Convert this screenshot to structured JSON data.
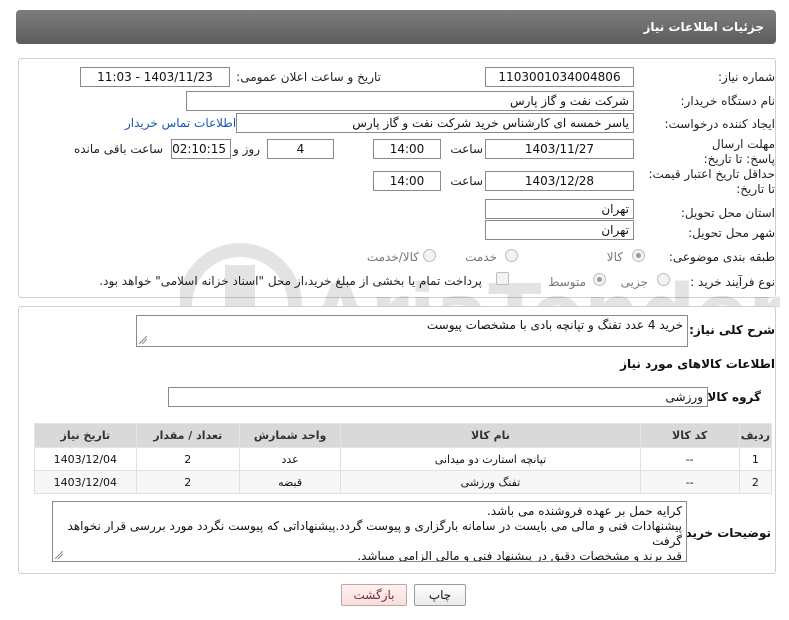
{
  "header": {
    "title": "جزئیات اطلاعات نیاز"
  },
  "labels": {
    "need_number": "شماره نیاز:",
    "announce_datetime": "تاریخ و ساعت اعلان عمومی:",
    "buyer_org": "نام دستگاه خریدار:",
    "requester": "ایجاد کننده درخواست:",
    "reply_deadline": "مهلت ارسال پاسخ: تا تاریخ:",
    "time": "ساعت",
    "day_and": "روز و",
    "remaining": "ساعت باقی مانده",
    "price_validity": "حداقل تاریخ اعتبار قیمت: تا تاریخ:",
    "delivery_province": "استان محل تحویل:",
    "delivery_city": "شهر محل تحویل:",
    "category": "طبقه بندی موضوعی:",
    "process_type": "نوع فرآیند خرید :",
    "general_desc": "شرح کلی نیاز:",
    "goods_info": "اطلاعات کالاهای مورد نیاز",
    "goods_group": "گروه کالا:",
    "buyer_notes": "توضیحات خریدار:"
  },
  "values": {
    "need_number": "1103001034004806",
    "announce_datetime": "1403/11/23 - 11:03",
    "buyer_org": "شرکت نفت و گاز پارس",
    "requester": "یاسر  خمسه ای کارشناس خرید  شرکت نفت و گاز پارس",
    "contact_link": "اطلاعات تماس خریدار",
    "reply_date": "1403/11/27",
    "reply_time": "14:00",
    "days": "4",
    "remaining_time": "02:10:15",
    "validity_date": "1403/12/28",
    "validity_time": "14:00",
    "province": "تهران",
    "city": "تهران",
    "general_desc": "خرید 4 عدد تفنگ و تپانچه بادی با مشخصات پیوست",
    "goods_group": "ورزشی"
  },
  "category_options": [
    {
      "label": "کالا",
      "selected": true
    },
    {
      "label": "خدمت",
      "selected": false
    },
    {
      "label": "کالا/خدمت",
      "selected": false
    }
  ],
  "process_options": [
    {
      "label": "جزیی",
      "selected": false
    },
    {
      "label": "متوسط",
      "selected": true
    }
  ],
  "treasury_note": "پرداخت تمام یا بخشی از مبلغ خرید،از محل \"اسناد خزانه اسلامی\" خواهد بود.",
  "table": {
    "headers": [
      "ردیف",
      "کد کالا",
      "نام کالا",
      "واحد شمارش",
      "تعداد / مقدار",
      "تاریخ نیاز"
    ],
    "rows": [
      [
        "1",
        "--",
        "تپانچه استارت دو میدانی",
        "عدد",
        "2",
        "1403/12/04"
      ],
      [
        "2",
        "--",
        "تفنگ ورزشی",
        "قبضه",
        "2",
        "1403/12/04"
      ]
    ]
  },
  "notes_lines": [
    "کرایه حمل بر عهده فروشنده می باشد.",
    "پیشنهادات فنی و مالی می بایست در سامانه بارگزاری و پیوست گردد.پیشنهاداتی که پیوست نگردد مورد بررسی قرار نخواهد گرفت",
    "قید برند و مشخصات دقیق در پیشنهاد فنی و مالی الزامی میباشد."
  ],
  "buttons": {
    "print": "چاپ",
    "back": "بازگشت"
  },
  "watermark": "AriaTender.net",
  "colors": {
    "header_bg": "#6b6b6b",
    "link": "#1a57b8",
    "table_header": "#d9d9d9"
  }
}
